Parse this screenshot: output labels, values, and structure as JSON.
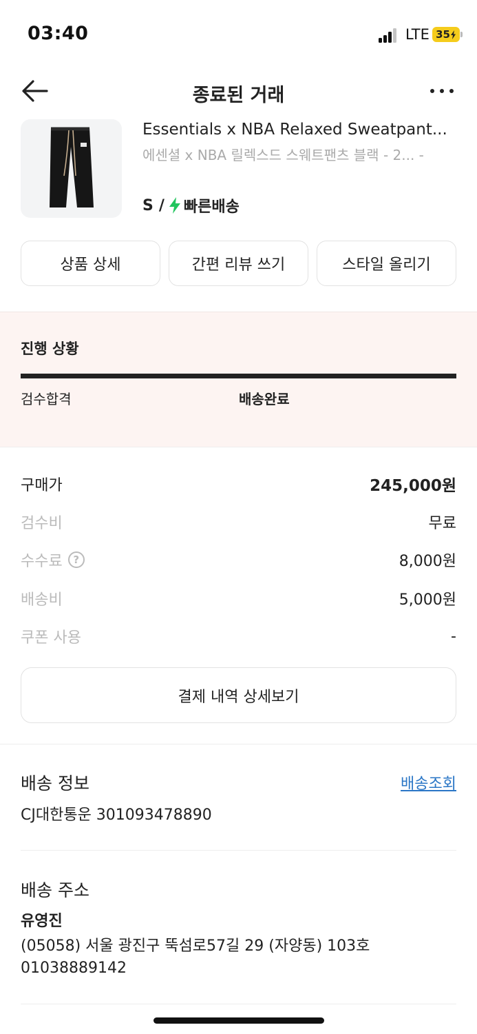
{
  "status_bar": {
    "time": "03:40",
    "network": "LTE",
    "battery": "35"
  },
  "header": {
    "title": "종료된 거래"
  },
  "product": {
    "name": "Essentials x NBA Relaxed Sweatpant...",
    "subtitle": "에센셜 x NBA 릴렉스드 스웨트팬츠 블랙 - 2... -",
    "size": "S",
    "separator": "/",
    "delivery": "빠른배송"
  },
  "actions": {
    "detail": "상품 상세",
    "review": "간편 리뷰 쓰기",
    "style": "스타일 올리기"
  },
  "progress": {
    "title": "진행 상황",
    "step1": "검수합격",
    "step2": "배송완료"
  },
  "price": {
    "purchase_label": "구매가",
    "purchase_value": "245,000원",
    "inspection_label": "검수비",
    "inspection_value": "무료",
    "fee_label": "수수료",
    "fee_value": "8,000원",
    "shipping_label": "배송비",
    "shipping_value": "5,000원",
    "coupon_label": "쿠폰 사용",
    "coupon_value": "-",
    "payment_detail": "결제 내역 상세보기"
  },
  "shipping": {
    "title": "배송 정보",
    "track_link": "배송조회",
    "carrier": "CJ대한통운 301093478890"
  },
  "address": {
    "title": "배송 주소",
    "name": "유영진",
    "line": "(05058) 서울 광진구 뚝섬로57길 29 (자양동) 103호",
    "phone": "01038889142"
  },
  "colors": {
    "accent_green": "#22c55e",
    "link_blue": "#2a76c6",
    "progress_bg": "#fdf4f2",
    "battery": "#f5cc1c"
  }
}
